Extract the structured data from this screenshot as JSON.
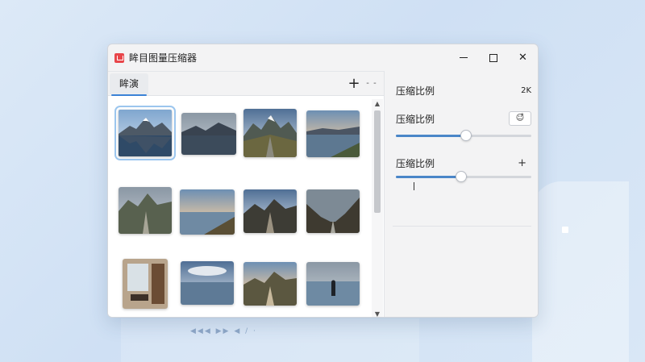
{
  "window": {
    "title": "眸目图量压缩器",
    "controls": {
      "minimize": "minimize-icon",
      "maximize": "maximize-icon",
      "close": "✕"
    }
  },
  "tabs": [
    {
      "label": "眸演"
    }
  ],
  "tab_actions": {
    "add": "+",
    "more": "- -"
  },
  "gallery": {
    "thumbnails": [
      {
        "name": "mountain-lake-reflection",
        "selected": true
      },
      {
        "name": "dark-lake"
      },
      {
        "name": "mountain-road"
      },
      {
        "name": "sunset-lake"
      },
      {
        "name": "valley-road"
      },
      {
        "name": "shore-sunset"
      },
      {
        "name": "road-mountains"
      },
      {
        "name": "dark-valley-road"
      },
      {
        "name": "interior-room"
      },
      {
        "name": "cloud-reflection"
      },
      {
        "name": "road-to-mountains"
      },
      {
        "name": "person-by-sea"
      }
    ]
  },
  "scrollbar": {
    "up": "▲",
    "down": "▼"
  },
  "settings": {
    "row1": {
      "label": "压缩比例",
      "value": "2K"
    },
    "row2": {
      "label": "压缩比例",
      "button": "☺̊"
    },
    "slider1": {
      "value_fraction": 0.52
    },
    "row3": {
      "label": "压缩比例",
      "action": "+"
    },
    "slider2": {
      "value_fraction": 0.48
    }
  },
  "background": {
    "dots_text": "◀◀◀ ▶▶ ◀ /   ·"
  },
  "colors": {
    "accent": "#3b82d6",
    "slider_fill": "#4a86c8",
    "app_icon": "#e8464a"
  }
}
